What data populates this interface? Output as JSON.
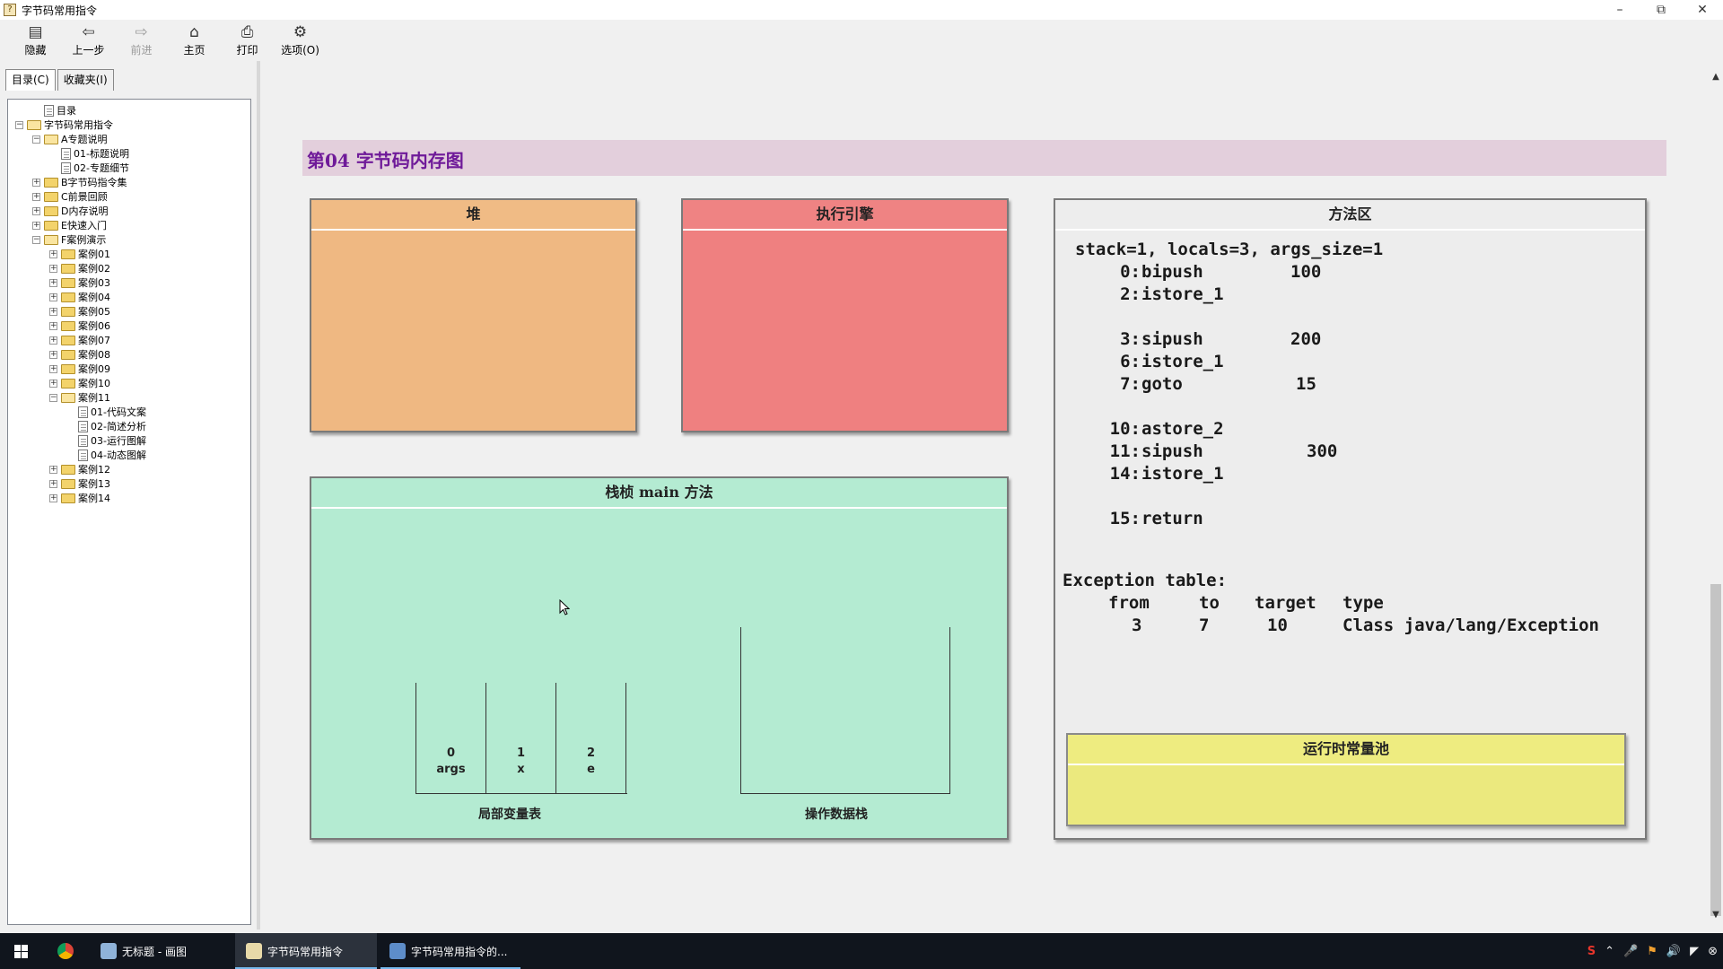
{
  "window": {
    "title": "字节码常用指令"
  },
  "toolbar": {
    "items": [
      {
        "label": "隐藏",
        "icon": "hide-icon",
        "glyph": "▤"
      },
      {
        "label": "上一步",
        "icon": "back-arrow-icon",
        "glyph": "⇦"
      },
      {
        "label": "前进",
        "icon": "forward-arrow-icon",
        "glyph": "⇨"
      },
      {
        "label": "主页",
        "icon": "home-icon",
        "glyph": "⌂"
      },
      {
        "label": "打印",
        "icon": "print-icon",
        "glyph": "⎙"
      },
      {
        "label": "选项(O)",
        "icon": "options-icon",
        "glyph": "⚙"
      }
    ]
  },
  "nav": {
    "tabs": [
      {
        "label": "目录(C)"
      },
      {
        "label": "收藏夹(I)"
      }
    ],
    "tree": [
      {
        "label": "目录",
        "type": "page",
        "toggle": "",
        "indent": 1
      },
      {
        "label": "字节码常用指令",
        "type": "folder-open",
        "toggle": "−",
        "indent": 0
      },
      {
        "label": "A专题说明",
        "type": "folder-open",
        "toggle": "−",
        "indent": 1
      },
      {
        "label": "01-标题说明",
        "type": "page",
        "toggle": "",
        "indent": 2
      },
      {
        "label": "02-专题细节",
        "type": "page",
        "toggle": "",
        "indent": 2
      },
      {
        "label": "B字节码指令集",
        "type": "folder",
        "toggle": "+",
        "indent": 1
      },
      {
        "label": "C前景回顾",
        "type": "folder",
        "toggle": "+",
        "indent": 1
      },
      {
        "label": "D内存说明",
        "type": "folder",
        "toggle": "+",
        "indent": 1
      },
      {
        "label": "E快速入门",
        "type": "folder",
        "toggle": "+",
        "indent": 1
      },
      {
        "label": "F案例演示",
        "type": "folder-open",
        "toggle": "−",
        "indent": 1
      },
      {
        "label": "案例01",
        "type": "folder",
        "toggle": "+",
        "indent": 2
      },
      {
        "label": "案例02",
        "type": "folder",
        "toggle": "+",
        "indent": 2
      },
      {
        "label": "案例03",
        "type": "folder",
        "toggle": "+",
        "indent": 2
      },
      {
        "label": "案例04",
        "type": "folder",
        "toggle": "+",
        "indent": 2
      },
      {
        "label": "案例05",
        "type": "folder",
        "toggle": "+",
        "indent": 2
      },
      {
        "label": "案例06",
        "type": "folder",
        "toggle": "+",
        "indent": 2
      },
      {
        "label": "案例07",
        "type": "folder",
        "toggle": "+",
        "indent": 2
      },
      {
        "label": "案例08",
        "type": "folder",
        "toggle": "+",
        "indent": 2
      },
      {
        "label": "案例09",
        "type": "folder",
        "toggle": "+",
        "indent": 2
      },
      {
        "label": "案例10",
        "type": "folder",
        "toggle": "+",
        "indent": 2
      },
      {
        "label": "案例11",
        "type": "folder-open",
        "toggle": "−",
        "indent": 2
      },
      {
        "label": "01-代码文案",
        "type": "page",
        "toggle": "",
        "indent": 3
      },
      {
        "label": "02-简述分析",
        "type": "page",
        "toggle": "",
        "indent": 3
      },
      {
        "label": "03-运行图解",
        "type": "page",
        "toggle": "",
        "indent": 3
      },
      {
        "label": "04-动态图解",
        "type": "page",
        "toggle": "",
        "indent": 3
      },
      {
        "label": "案例12",
        "type": "folder",
        "toggle": "+",
        "indent": 2
      },
      {
        "label": "案例13",
        "type": "folder",
        "toggle": "+",
        "indent": 2
      },
      {
        "label": "案例14",
        "type": "folder",
        "toggle": "+",
        "indent": 2
      }
    ]
  },
  "slide": {
    "title": "第04 字节码内存图",
    "heap": {
      "title": "堆",
      "color": "#efb882"
    },
    "engine": {
      "title": "执行引擎",
      "color": "#ef8080"
    },
    "frame": {
      "title": "栈桢 main 方法",
      "color": "#b4ebd2",
      "locals": [
        {
          "index": "0",
          "name": "args"
        },
        {
          "index": "1",
          "name": "x"
        },
        {
          "index": "2",
          "name": "e"
        }
      ],
      "locals_label": "局部变量表",
      "operand_label": "操作数据栈"
    },
    "method_area": {
      "title": "方法区",
      "header_line": "stack=1, locals=3, args_size=1",
      "instructions": [
        {
          "offset": "0:",
          "op": "bipush",
          "arg": "100"
        },
        {
          "offset": "2:",
          "op": "istore_1",
          "arg": ""
        },
        {
          "offset": "3:",
          "op": "sipush",
          "arg": "200"
        },
        {
          "offset": "6:",
          "op": "istore_1",
          "arg": ""
        },
        {
          "offset": "7:",
          "op": "goto",
          "arg": "15"
        },
        {
          "offset": "10:",
          "op": "astore_2",
          "arg": ""
        },
        {
          "offset": "11:",
          "op": "sipush",
          "arg": "300"
        },
        {
          "offset": "14:",
          "op": "istore_1",
          "arg": ""
        },
        {
          "offset": "15:",
          "op": "return",
          "arg": ""
        }
      ],
      "exception_title": "Exception table:",
      "exception_headers": {
        "from": "from",
        "to": "to",
        "target": "target",
        "type": "type"
      },
      "exception_row": {
        "from": "3",
        "to": "7",
        "target": "10",
        "type": "Class java/lang/Exception"
      },
      "constant_pool": {
        "title": "运行时常量池",
        "color": "#ebe97e"
      }
    }
  },
  "taskbar": {
    "items": [
      {
        "label": "无标题 - 画图"
      },
      {
        "label": "字节码常用指令"
      },
      {
        "label": "字节码常用指令的..."
      }
    ]
  }
}
